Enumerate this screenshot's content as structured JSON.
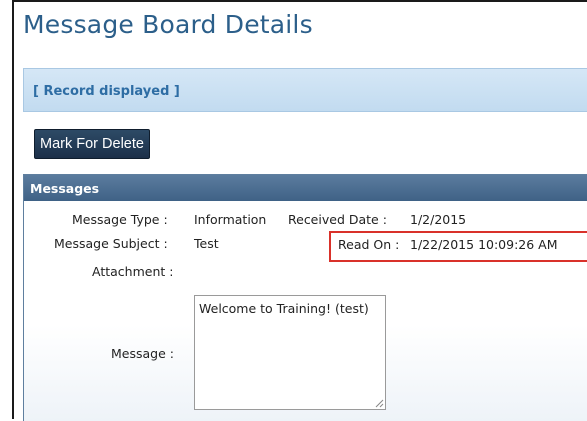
{
  "page": {
    "title": "Message Board Details"
  },
  "status": {
    "text": "[ Record displayed ]"
  },
  "actions": {
    "mark_for_delete": "Mark For Delete"
  },
  "panel": {
    "header": "Messages",
    "fields": {
      "message_type_label": "Message Type :",
      "message_type_value": "Information",
      "received_date_label": "Received Date :",
      "received_date_value": "1/2/2015",
      "subject_label": "Message Subject :",
      "subject_value": "Test",
      "read_on_label": "Read On :",
      "read_on_value": "1/22/2015 10:09:26 AM",
      "attachment_label": "Attachment :",
      "message_label": "Message :",
      "message_value": "Welcome to Training! (test)"
    }
  },
  "colors": {
    "title": "#2c5f8a",
    "status_bg": "#c9e0f3",
    "status_text": "#2e6da4",
    "button_bg": "#1f3550",
    "panel_header": "#4a6c90",
    "highlight_border": "#d9312a"
  },
  "icons": {
    "resize_grip": "resize-grip-icon"
  }
}
